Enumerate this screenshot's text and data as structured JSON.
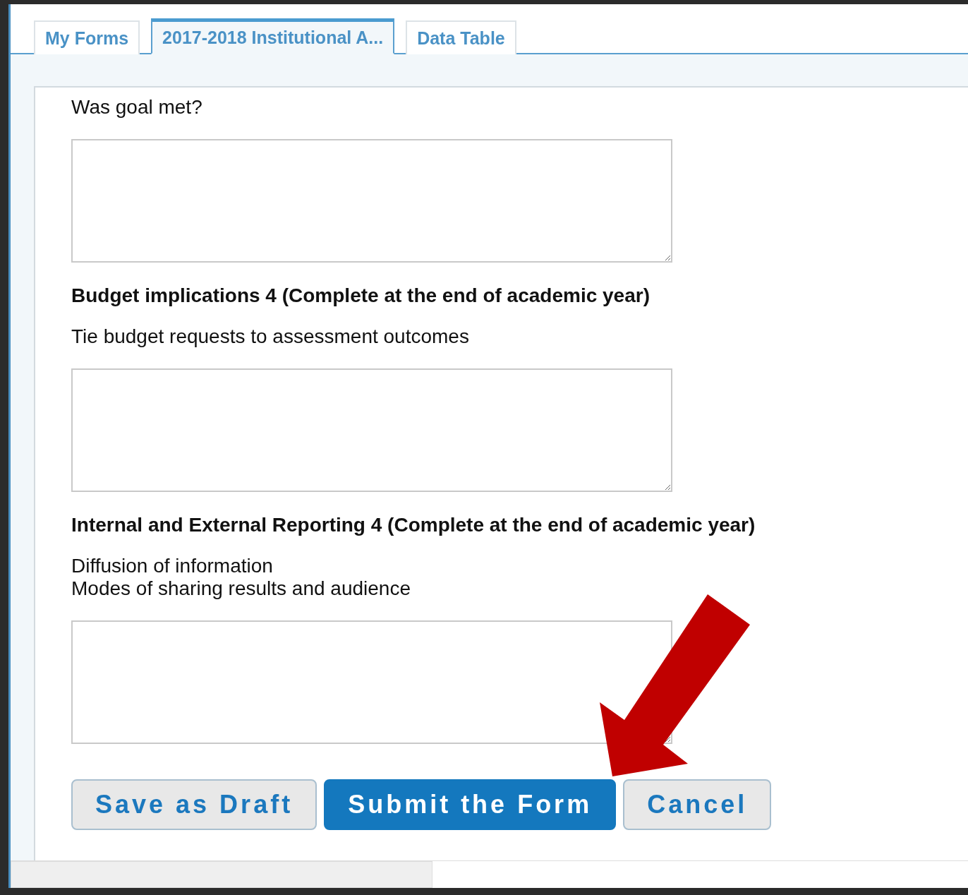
{
  "tabs": [
    {
      "label": "My Forms",
      "selected": false
    },
    {
      "label": "2017-2018 Institutional A...",
      "selected": true
    },
    {
      "label": "Data Table",
      "selected": false
    }
  ],
  "form": {
    "sections": [
      {
        "lines": [
          "Was goal met?"
        ]
      },
      {
        "heading": "Budget implications 4 (Complete at the end of academic year)",
        "lines": [
          "Tie budget requests to assessment outcomes"
        ]
      },
      {
        "heading": "Internal and External Reporting 4 (Complete at the end of academic year)",
        "lines": [
          "Diffusion of information",
          "Modes of sharing results and audience"
        ]
      }
    ]
  },
  "buttons": [
    {
      "label": "Save as Draft",
      "kind": "secondary"
    },
    {
      "label": "Submit the Form",
      "kind": "primary"
    },
    {
      "label": "Cancel",
      "kind": "secondary"
    }
  ]
}
